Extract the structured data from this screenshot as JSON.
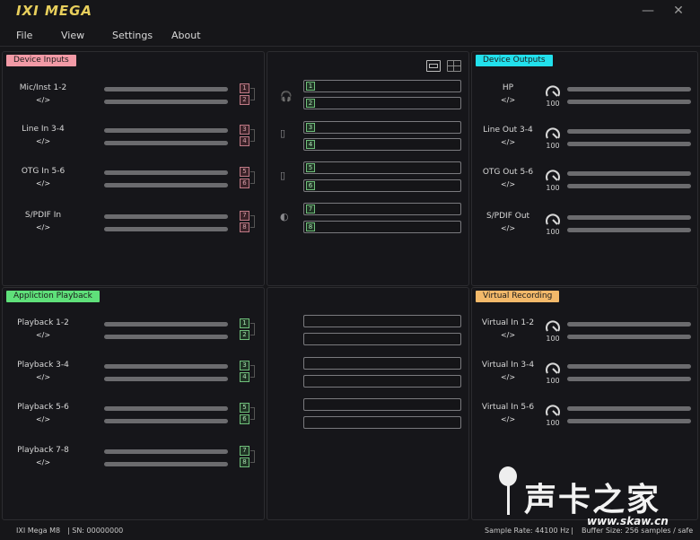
{
  "app": {
    "logo": "IXI MEGA",
    "minimize": "—",
    "close": "✕"
  },
  "menu": [
    "File",
    "View",
    "Settings",
    "About"
  ],
  "inputs": {
    "label": "Device Inputs",
    "color": "#f29aa6",
    "rows": [
      {
        "name": "Mic/Inst 1-2",
        "link": "</>",
        "ch": [
          "1",
          "2"
        ]
      },
      {
        "name": "Line In 3-4",
        "link": "</>",
        "ch": [
          "3",
          "4"
        ]
      },
      {
        "name": "OTG In 5-6",
        "link": "</>",
        "ch": [
          "5",
          "6"
        ]
      },
      {
        "name": "S/PDIF In",
        "link": "</>",
        "ch": [
          "7",
          "8"
        ]
      }
    ]
  },
  "playback": {
    "label": "Appliction Playback",
    "color": "#5fe07a",
    "rows": [
      {
        "name": "Playback 1-2",
        "link": "</>",
        "ch": [
          "1",
          "2"
        ]
      },
      {
        "name": "Playback 3-4",
        "link": "</>",
        "ch": [
          "3",
          "4"
        ]
      },
      {
        "name": "Playback 5-6",
        "link": "</>",
        "ch": [
          "5",
          "6"
        ]
      },
      {
        "name": "Playback 7-8",
        "link": "</>",
        "ch": [
          "7",
          "8"
        ]
      }
    ]
  },
  "routing": {
    "slots": [
      "1",
      "2",
      "3",
      "4",
      "5",
      "6",
      "7",
      "8"
    ],
    "icons": [
      "headphones-icon",
      "speaker-icon",
      "phone-icon",
      "spdif-icon"
    ],
    "glyphs": [
      "🎧",
      "▯",
      "▯",
      "◐"
    ]
  },
  "outputs": {
    "label": "Device Outputs",
    "color": "#22e0ec",
    "rows": [
      {
        "name": "HP",
        "link": "</>",
        "value": "100"
      },
      {
        "name": "Line Out 3-4",
        "link": "</>",
        "value": "100"
      },
      {
        "name": "OTG Out 5-6",
        "link": "</>",
        "value": "100"
      },
      {
        "name": "S/PDIF Out",
        "link": "</>",
        "value": "100"
      }
    ]
  },
  "recording": {
    "label": "Virtual Recording",
    "color": "#f3b96a",
    "rows": [
      {
        "name": "Virtual In 1-2",
        "link": "</>",
        "value": "100"
      },
      {
        "name": "Virtual In 3-4",
        "link": "</>",
        "value": "100"
      },
      {
        "name": "Virtual In 5-6",
        "link": "</>",
        "value": "100"
      }
    ]
  },
  "status": {
    "device": "IXI Mega M8",
    "sn": "| SN: 00000000",
    "sample": "Sample Rate: 44100 Hz",
    "sep": "|",
    "buffer": "Buffer Size: 256 samples / safe"
  },
  "watermark": {
    "text": "声卡之家",
    "url": "www.skaw.cn"
  }
}
